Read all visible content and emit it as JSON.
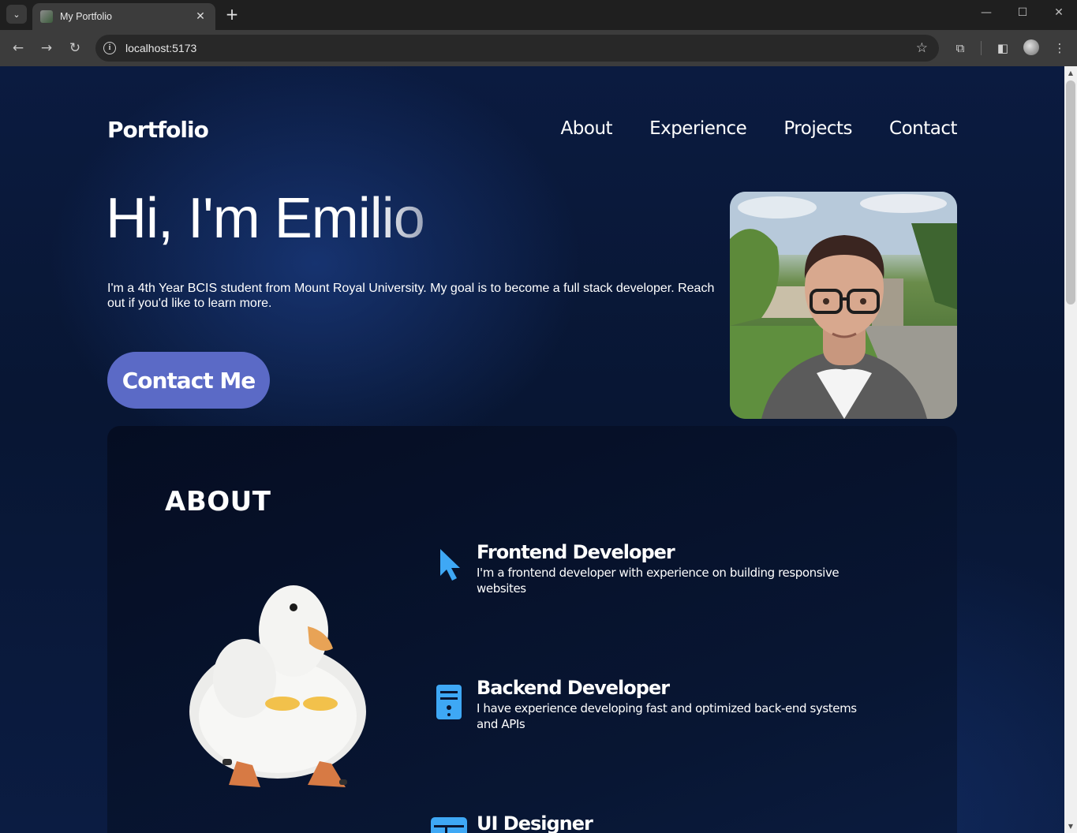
{
  "browser": {
    "tab_title": "My Portfolio",
    "url": "localhost:5173",
    "icons": [
      "tab-search-icon",
      "favicon-icon",
      "close-icon",
      "plus-icon",
      "back-icon",
      "forward-icon",
      "reload-icon",
      "info-icon",
      "star-icon",
      "extensions-icon",
      "sidebar-icon",
      "profile-icon",
      "menu-icon",
      "minimize-icon",
      "maximize-icon",
      "close-window-icon"
    ]
  },
  "page": {
    "brand": "Portfolio",
    "nav": [
      "About",
      "Experience",
      "Projects",
      "Contact"
    ],
    "hero": {
      "title_main": "Hi, I'm Emi",
      "title_fade": "lio",
      "description": "I'm a 4th Year BCIS student from Mount Royal University. My goal is to become a full stack developer. Reach out if you'd like to learn more.",
      "cta": "Contact Me"
    },
    "about": {
      "heading": "ABOUT",
      "roles": [
        {
          "icon": "cursor-icon",
          "title": "Frontend Developer",
          "description": "I'm a frontend developer with experience on building responsive websites"
        },
        {
          "icon": "server-icon",
          "title": "Backend Developer",
          "description": "I have experience developing fast and optimized back-end systems and APIs"
        },
        {
          "icon": "layout-icon",
          "title": "UI Designer",
          "description": ""
        }
      ]
    },
    "colors": {
      "accent": "#5b6ac6",
      "background": "#0b1b40",
      "icon_blue": "#3ea8f5"
    }
  }
}
